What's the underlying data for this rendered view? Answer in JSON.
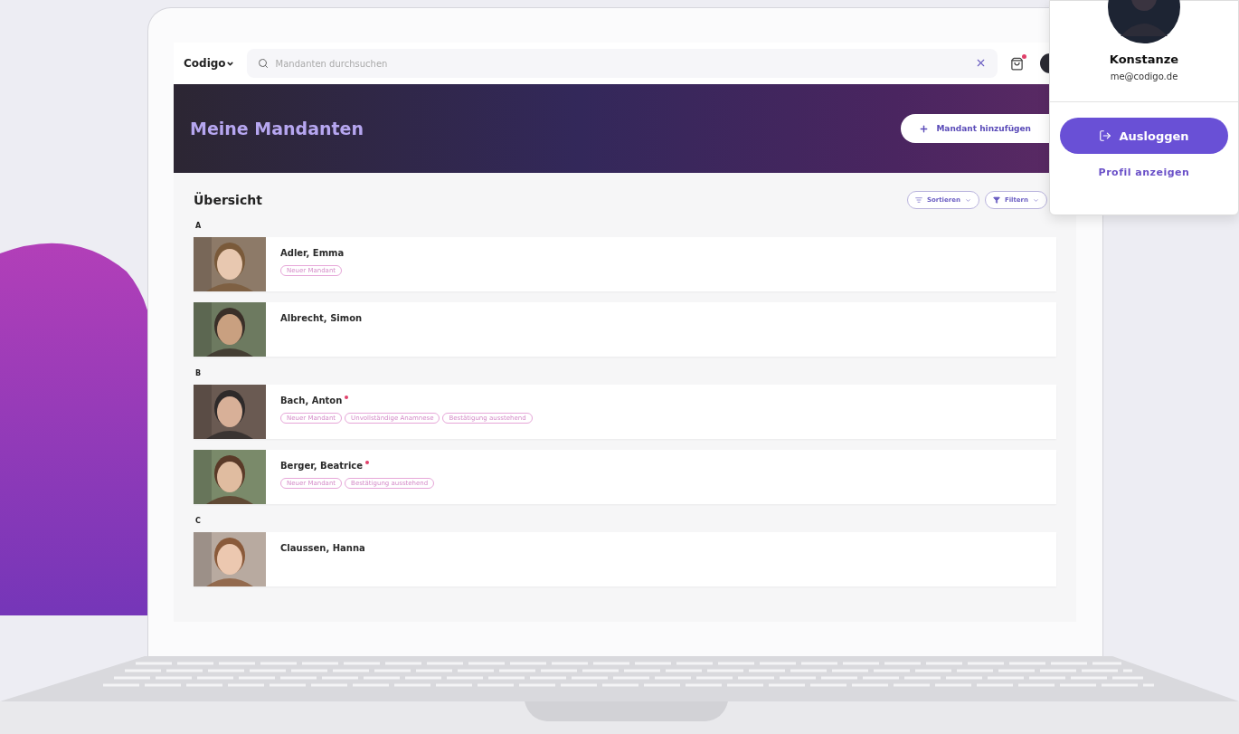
{
  "topbar": {
    "logo": "Codigo",
    "search": {
      "placeholder": "Mandanten durchsuchen"
    },
    "notifications": {
      "unread": true
    }
  },
  "banner": {
    "title": "Meine Mandanten",
    "add_button": "Mandant hinzufügen"
  },
  "overview": {
    "title": "Übersicht",
    "sort_button": "Sortieren",
    "filter_button": "Filtern"
  },
  "groups": [
    {
      "letter": "A",
      "clients": [
        {
          "name": "Adler, Emma",
          "flagged": false,
          "tags": [
            "Neuer Mandant"
          ]
        },
        {
          "name": "Albrecht, Simon",
          "flagged": false
        }
      ]
    },
    {
      "letter": "B",
      "clients": [
        {
          "name": "Bach, Anton",
          "flagged": true,
          "tags": [
            "Neuer Mandant",
            "Unvollständige Anamnese",
            "Bestätigung ausstehend"
          ]
        },
        {
          "name": "Berger, Beatrice",
          "flagged": true,
          "tags": [
            "Neuer Mandant",
            "Bestätigung ausstehend"
          ]
        }
      ]
    },
    {
      "letter": "C",
      "clients": [
        {
          "name": "Claussen, Hanna",
          "flagged": false
        }
      ]
    }
  ],
  "profile_menu": {
    "name": "Konstanze",
    "email": "me@codigo.de",
    "logout_button": "Ausloggen",
    "profile_link": "Profil anzeigen"
  }
}
